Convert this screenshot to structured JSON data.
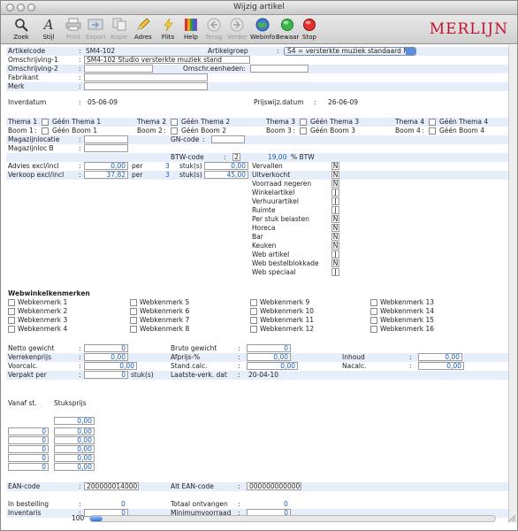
{
  "window": {
    "title": "Wijzig artikel"
  },
  "toolbar": {
    "items": [
      {
        "label": "Zoek",
        "icon": "magnifier-icon",
        "enabled": true
      },
      {
        "label": "Stijl",
        "icon": "italic-a-icon",
        "enabled": true
      },
      {
        "label": "Print",
        "icon": "printer-icon",
        "enabled": false
      },
      {
        "label": "Export",
        "icon": "export-icon",
        "enabled": false
      },
      {
        "label": "Kopie",
        "icon": "copy-icon",
        "enabled": false
      },
      {
        "label": "Adres",
        "icon": "pencil-icon",
        "enabled": true
      },
      {
        "label": "Flits",
        "icon": "lightning-icon",
        "enabled": true
      },
      {
        "label": "Help",
        "icon": "help-book-icon",
        "enabled": true
      },
      {
        "label": "Terug",
        "icon": "back-arrow-icon",
        "enabled": false
      },
      {
        "label": "Verder",
        "icon": "forward-arrow-icon",
        "enabled": false
      },
      {
        "label": "Webinfo",
        "icon": "globe-icon",
        "enabled": true
      },
      {
        "label": "Bewaar",
        "icon": "green-dot-icon",
        "enabled": true
      },
      {
        "label": "Stop",
        "icon": "red-stop-icon",
        "enabled": true
      }
    ],
    "brand": "MERLIJN"
  },
  "colors": {
    "accent_blue": "#1a5fb4",
    "brand_red": "#c41230",
    "stripe": "#e7eefb"
  },
  "header": {
    "artikelcode_label": "Artikelcode",
    "artikelcode_value": "SM4-102",
    "artikelgroep_label": "Artikelgroep",
    "artikelgroep_value": "S4   = versterkte muziek standaard M4",
    "omschr1_label": "Omschrijving-1",
    "omschr1_value": "SM4-102 Studio versterkte muziek stand",
    "omschr2_label": "Omschrijving-2",
    "omschr_eenh_label": "Omschr.eenheden",
    "fabrikant_label": "Fabrikant",
    "merk_label": "Merk",
    "inverdatum_label": "Inverdatum",
    "inverdatum_value": "05-06-09",
    "prijswijz_label": "Prijswijz.datum",
    "prijswijz_value": "26-06-09"
  },
  "themas": {
    "thema_labels": [
      "Thema 1",
      "Thema 2",
      "Thema 3",
      "Thema 4"
    ],
    "thema_values": [
      "Géén Thema 1",
      "Géén Thema 2",
      "Géén Thema 3",
      "Géén Thema 4"
    ],
    "boom_labels": [
      "Boom 1",
      "Boom 2",
      "Boom 3",
      "Boom 4"
    ],
    "boom_values": [
      "Géén Boom 1",
      "Géén Boom 2",
      "Géén Boom 3",
      "Géén Boom 4"
    ]
  },
  "magazijn": {
    "locatie_label": "Magazijnlocatie",
    "locatie_b_label": "Magazijnloc B",
    "gn_label": "GN-code"
  },
  "btw": {
    "label": "BTW-code",
    "code": "2",
    "pct": "19,00",
    "pct_suffix": "% BTW"
  },
  "prices": {
    "advies_label": "Advies excl/incl",
    "advies_excl": "0,00",
    "advies_per": "per",
    "advies_qty": "3",
    "advies_unit": "stuk(s)",
    "advies_incl": "0,00",
    "verkoop_label": "Verkoop excl/incl",
    "verkoop_excl": "37,82",
    "verkoop_per": "per",
    "verkoop_qty": "3",
    "verkoop_unit": "stuk(s)",
    "verkoop_incl": "45,00"
  },
  "flags": [
    {
      "label": "Vervallen",
      "value": "N"
    },
    {
      "label": "Uitverkocht",
      "value": "N"
    },
    {
      "label": "Voorraad negeren",
      "value": "N"
    },
    {
      "label": "Winkelartikel",
      "value": "J"
    },
    {
      "label": "Verhuurartikel",
      "value": "J"
    },
    {
      "label": "Ruimte",
      "value": "J"
    },
    {
      "label": "Per stuk belasten",
      "value": "N"
    },
    {
      "label": "Horeca",
      "value": "N"
    },
    {
      "label": "Bar",
      "value": "N"
    },
    {
      "label": "Keuken",
      "value": "N"
    },
    {
      "label": "Web artikel",
      "value": "J"
    },
    {
      "label": "Web bestelblokkade",
      "value": "N"
    },
    {
      "label": "Web speciaal",
      "value": "J"
    }
  ],
  "webwinkel": {
    "title": "Webwinkelkenmerken",
    "items": [
      "Webkenmerk 1",
      "Webkenmerk 2",
      "Webkenmerk 3",
      "Webkenmerk 4",
      "Webkenmerk 5",
      "Webkenmerk 6",
      "Webkenmerk 7",
      "Webkenmerk 8",
      "Webkenmerk 9",
      "Webkenmerk 10",
      "Webkenmerk 11",
      "Webkenmerk 12",
      "Webkenmerk 13",
      "Webkenmerk 14",
      "Webkenmerk 15",
      "Webkenmerk 16"
    ]
  },
  "measures": {
    "netto_label": "Netto gewicht",
    "netto_value": "0",
    "bruto_label": "Bruto gewicht",
    "bruto_value": "0",
    "verreken_label": "Verrekenprijs",
    "verreken_value": "0,00",
    "afprijs_label": "Afprijs-%",
    "afprijs_value": "0,00",
    "inhoud_label": "Inhoud",
    "inhoud_value": "0,00",
    "voorcalc_label": "Voorcalc.",
    "voorcalc_value": "0,00",
    "standcalc_label": "Stand.calc.",
    "standcalc_value": "0,00",
    "nacalc_label": "Nacalc.",
    "nacalc_value": "0,00",
    "verpakt_label": "Verpakt per",
    "verpakt_value": "0",
    "verpakt_unit": "stuk(s)",
    "laatste_label": "Laatste-verk. dat",
    "laatste_value": "20-04-10"
  },
  "staffel": {
    "vanaf_label": "Vanaf   st.",
    "stuks_label": "Stuksprijs",
    "rows": [
      {
        "vanaf": "0",
        "prijs": "0,00"
      },
      {
        "vanaf": "0",
        "prijs": "0,00"
      },
      {
        "vanaf": "0",
        "prijs": "0,00"
      },
      {
        "vanaf": "0",
        "prijs": "0,00"
      },
      {
        "vanaf": "0",
        "prijs": "0,00"
      }
    ],
    "top_prijs": "0,00"
  },
  "codes": {
    "ean_label": "EAN-code",
    "ean_value": "2000000140001",
    "alt_ean_label": "Alt EAN-code",
    "alt_ean_value": "0000000000000"
  },
  "stock": {
    "bestelling_label": "In bestelling",
    "bestelling_value": "0",
    "totaal_label": "Totaal ontvangen",
    "totaal_value": "0",
    "inventaris_label": "Inventaris",
    "inventaris_value": "0",
    "minimum_label": "Minimumvoorraad",
    "minimum_value": "0"
  },
  "statusbar": {
    "zoom": "100"
  }
}
